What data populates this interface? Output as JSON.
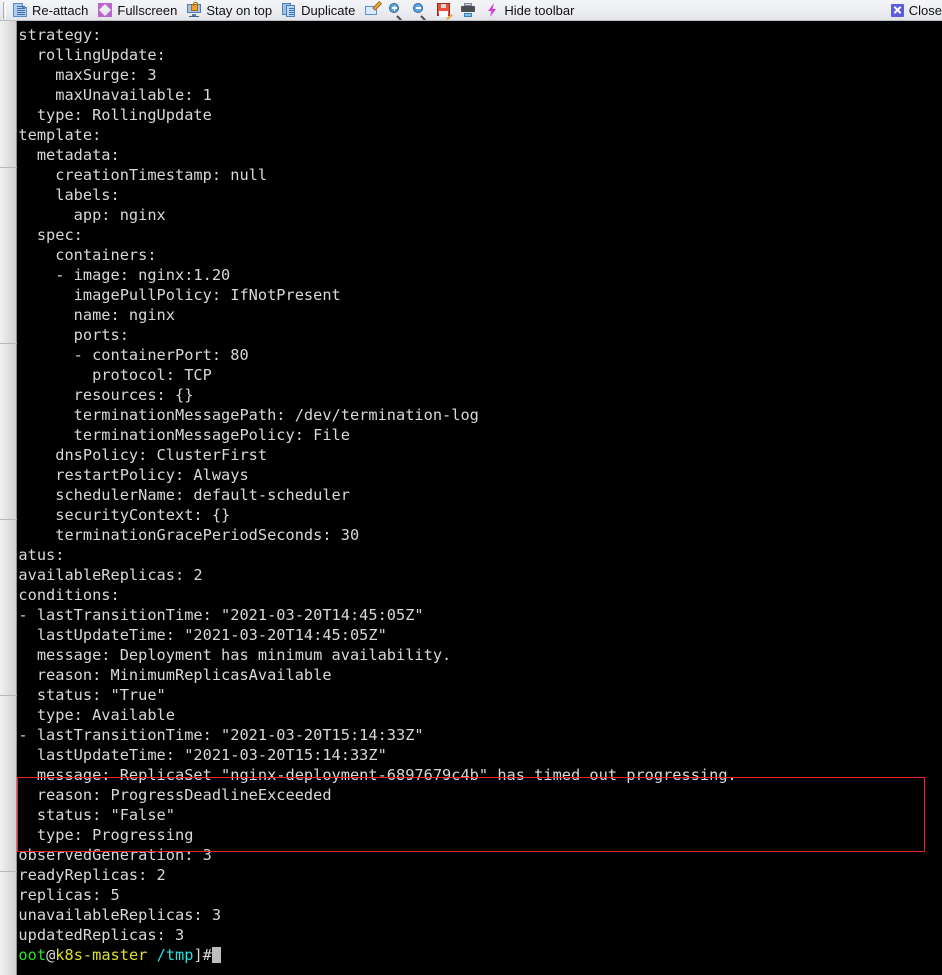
{
  "toolbar": {
    "items": [
      {
        "label": "Re-attach",
        "icon": "document-icon"
      },
      {
        "label": "Fullscreen",
        "icon": "fullscreen-icon"
      },
      {
        "label": "Stay on top",
        "icon": "monitor-lock-icon"
      },
      {
        "label": "Duplicate",
        "icon": "duplicate-icon"
      },
      {
        "label": "",
        "icon": "edit-icon"
      },
      {
        "label": "",
        "icon": "zoom-in-icon"
      },
      {
        "label": "",
        "icon": "zoom-out-icon"
      },
      {
        "label": "",
        "icon": "save-icon"
      },
      {
        "label": "",
        "icon": "print-icon"
      },
      {
        "label": "Hide toolbar",
        "icon": "lightning-icon"
      }
    ],
    "close_label": "Close",
    "close_icon": "close-icon"
  },
  "terminal": {
    "lines": [
      "  strategy:",
      "    rollingUpdate:",
      "      maxSurge: 3",
      "      maxUnavailable: 1",
      "    type: RollingUpdate",
      "  template:",
      "    metadata:",
      "      creationTimestamp: null",
      "      labels:",
      "        app: nginx",
      "    spec:",
      "      containers:",
      "      - image: nginx:1.20",
      "        imagePullPolicy: IfNotPresent",
      "        name: nginx",
      "        ports:",
      "        - containerPort: 80",
      "          protocol: TCP",
      "        resources: {}",
      "        terminationMessagePath: /dev/termination-log",
      "        terminationMessagePolicy: File",
      "      dnsPolicy: ClusterFirst",
      "      restartPolicy: Always",
      "      schedulerName: default-scheduler",
      "      securityContext: {}",
      "      terminationGracePeriodSeconds: 30",
      "status:",
      "  availableReplicas: 2",
      "  conditions:",
      "  - lastTransitionTime: \"2021-03-20T14:45:05Z\"",
      "    lastUpdateTime: \"2021-03-20T14:45:05Z\"",
      "    message: Deployment has minimum availability.",
      "    reason: MinimumReplicasAvailable",
      "    status: \"True\"",
      "    type: Available",
      "  - lastTransitionTime: \"2021-03-20T15:14:33Z\"",
      "    lastUpdateTime: \"2021-03-20T15:14:33Z\"",
      "    message: ReplicaSet \"nginx-deployment-6897679c4b\" has timed out progressing.",
      "    reason: ProgressDeadlineExceeded",
      "    status: \"False\"",
      "    type: Progressing",
      "  observedGeneration: 3",
      "  readyReplicas: 2",
      "  replicas: 5",
      "  unavailableReplicas: 3",
      "  updatedReplicas: 3"
    ],
    "prompt": {
      "bracket_open": "[",
      "user": "root",
      "at": "@",
      "host": "k8s-master",
      "space": " ",
      "path": "/tmp",
      "bracket_close": "]#",
      "colors": {
        "bracket": "#2ae0e0",
        "user": "#2ce02c",
        "at": "#d8d8d8",
        "host": "#e0e02c",
        "path": "#2ae0e0",
        "cursor": "#bdbdbd"
      }
    },
    "highlight": {
      "color": "#ee2222",
      "covers": [
        "message: ReplicaSet \"nginx-deployment-6897679c4b\" has timed out progressing.",
        "reason: ProgressDeadlineExceeded",
        "status: \"False\"",
        "type: Progressing"
      ]
    },
    "background": "#000000",
    "foreground": "#d8d8d8"
  }
}
